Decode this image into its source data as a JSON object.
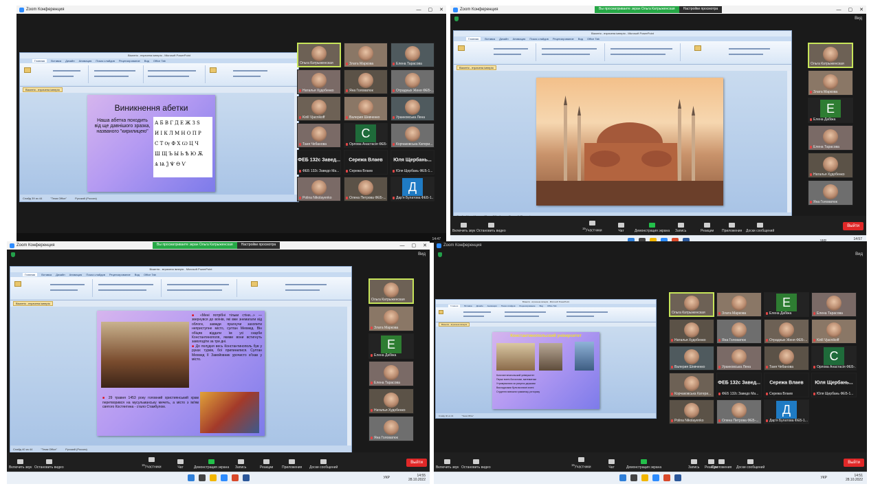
{
  "window_title": "Zoom Конференция",
  "view_label": "Вид",
  "share_banner": {
    "text": "Вы просматриваете экран Ольга Катрыженская",
    "options": "Настройки просмотра"
  },
  "ppt_title": "Візантія - втрачена імперія - Microsoft PowerPoint",
  "ppt_tabs": [
    "Главная",
    "Вставка",
    "Дизайн",
    "Анимация",
    "Показ слайдов",
    "Рецензирование",
    "Вид",
    "Office Tab"
  ],
  "ppt_doc_tab": "Візантія - втрачена імперія",
  "ppt_status": {
    "q1": "Слайд 39 из 44",
    "q2": "Слайд 44 из 44",
    "q3": "Слайд 40 из 44",
    "theme": "\"Тема Office\"",
    "lang": "Русский (Россия)"
  },
  "slide_q1": {
    "title": "Виникнення абетки",
    "body": "Наша абетка походить від ще давнішого зразка, названого \"кирилицею\"",
    "alphabet_rows": [
      "А Б В Г Д Е Ж З Ѕ",
      "И І К Л М Н О П Р",
      "С Т Ѹ Ф Х Ѡ Ц Ч",
      "Ш Щ Ъ Ы Ь Ѣ Ю Ѫ",
      "Ѧ Ѩ Ѯ Ѱ Ѳ Ѵ"
    ]
  },
  "slide_q3": {
    "text1": "«Мені потрібні тільки стіни...» — звернувся до воїнів, які вже знемагали від облоги, завжди прагнучи захопити неприступне місто, султан Мехмед. Він обіцяв віддати їм усі скарби Константинополя, якими вони встигнуть заволодіти за три дні.",
    "text2": "До полудня весь Константинополь був у руках турків, бої припинилися. Султан Мехмед ІІ Завойовник урочисто в'їхав у місто.",
    "text3": "29 травня 1453 року головний християнський храм перетворився на мусульманську мечеть, а місто з ім'ям святого Костянтина - стало Стамбулом."
  },
  "slide_q4": {
    "title": "Константинопольский університет",
    "bullets": [
      "Константинопольский університет",
      "Перші вчені-богослови, математики",
      "Утримувалися за рахунок держави",
      "Викладачами були визначні вчені",
      "Студенти вивчали граматику, риторику"
    ]
  },
  "participants": {
    "q1": [
      {
        "name": "Ольга Катрыженская",
        "type": "video",
        "active": true
      },
      {
        "name": "Злата Маркова",
        "type": "video"
      },
      {
        "name": "Елена Тарасова",
        "type": "video"
      },
      {
        "name": "Наталья Худобенко",
        "type": "video"
      },
      {
        "name": "Яна Головатюк",
        "type": "video"
      },
      {
        "name": "Отрадных Женя ФЕБ-...",
        "type": "video"
      },
      {
        "name": "Kirill Vjacnikoff",
        "type": "video"
      },
      {
        "name": "Валерия Шевченко",
        "type": "video"
      },
      {
        "name": "Уранковська Лена",
        "type": "video"
      },
      {
        "name": "Таня Чебанова",
        "type": "video"
      },
      {
        "name": "Орлова Анастасія ФЕБ-...",
        "type": "letter",
        "letter": "С",
        "color": "#1f6b3a"
      },
      {
        "name": "Корчаковська Катери...",
        "type": "video"
      },
      {
        "name": "ФЕБ 132с Завед...",
        "sub": "ФЕБ 132с Заведо Ма...",
        "type": "name"
      },
      {
        "name": "Сережа Влаев",
        "sub": "Сережа Влаев",
        "type": "name"
      },
      {
        "name": "Юля Щербань...",
        "sub": "Юля Щербань ФЕБ-1...",
        "type": "name"
      },
      {
        "name": "Polina Nikolayenko",
        "type": "video"
      },
      {
        "name": "Олена Петрова ФЕБ-...",
        "type": "video"
      },
      {
        "name": "Дар'я Булатова ФЕБ-1...",
        "type": "letter",
        "letter": "Д",
        "color": "#1f7bc4"
      }
    ],
    "q2": [
      {
        "name": "Ольга Катрыженская",
        "type": "video",
        "active": true
      },
      {
        "name": "Злата Маркова",
        "type": "video"
      },
      {
        "name": "Елена Дабіжа",
        "type": "letter",
        "letter": "Е",
        "color": "#2e7d32"
      },
      {
        "name": "Елена Тарасова",
        "type": "video"
      },
      {
        "name": "Наталья Худобенко",
        "type": "video"
      },
      {
        "name": "Яна Головатюк",
        "type": "video"
      }
    ],
    "q3": [
      {
        "name": "Ольга Катрыженская",
        "type": "video",
        "active": true
      },
      {
        "name": "Злата Маркова",
        "type": "video"
      },
      {
        "name": "Елена Дабіжа",
        "type": "letter",
        "letter": "Е",
        "color": "#2e7d32"
      },
      {
        "name": "Елена Тарасова",
        "type": "video"
      },
      {
        "name": "Наталья Худобенко",
        "type": "video"
      },
      {
        "name": "Яна Головатюк",
        "type": "video"
      }
    ],
    "q4": [
      {
        "name": "Ольга Катрыженская",
        "type": "video",
        "active": true
      },
      {
        "name": "Злата Маркова",
        "type": "video"
      },
      {
        "name": "Елена Дабіжа",
        "type": "letter",
        "letter": "Е",
        "color": "#2e7d32"
      },
      {
        "name": "Елена Тарасова",
        "type": "video"
      },
      {
        "name": "Наталья Худобенко",
        "type": "video"
      },
      {
        "name": "Яна Головатюк",
        "type": "video"
      },
      {
        "name": "Отрадных Женя ФЕБ-...",
        "type": "video"
      },
      {
        "name": "Kirill Vjacnikoff",
        "type": "video"
      },
      {
        "name": "Валерия Шевченко",
        "type": "video"
      },
      {
        "name": "Уранковська Лена",
        "type": "video"
      },
      {
        "name": "Таня Чебанова",
        "type": "video"
      },
      {
        "name": "Орлова Анастасія ФЕБ-...",
        "type": "letter",
        "letter": "С",
        "color": "#1f6b3a"
      },
      {
        "name": "Корчаковська Катери...",
        "type": "video"
      },
      {
        "name": "ФЕБ 132с Завед...",
        "sub": "ФЕБ 132с Заведо Ма...",
        "type": "name"
      },
      {
        "name": "Сережа Влаев",
        "sub": "Сережа Влаев",
        "type": "name"
      },
      {
        "name": "Юля Щербань...",
        "sub": "Юля Щербань ФЕБ-1...",
        "type": "name"
      },
      {
        "name": "Polina Nikolayenko",
        "type": "video"
      },
      {
        "name": "Олена Петрова ФЕБ-...",
        "type": "video"
      },
      {
        "name": "Дар'я Булатова ФЕБ-1...",
        "type": "letter",
        "letter": "Д",
        "color": "#1f7bc4"
      }
    ]
  },
  "toolbar": {
    "mute": "Включить звук",
    "video": "Остановить видео",
    "participants": "Участники",
    "participants_count": "19",
    "chat": "Чат",
    "share": "Демонстрация экрана",
    "record": "Запись",
    "reactions": "Реакции",
    "apps": "Приложения",
    "whiteboards": "Доски сообщений",
    "leave": "Выйти"
  },
  "taskbar": {
    "lang": "УКР",
    "q1_time": "14:47",
    "q2_time": "14:57",
    "q3_time": "14:55",
    "q4_time": "14:51",
    "date": "28.10.2022"
  }
}
